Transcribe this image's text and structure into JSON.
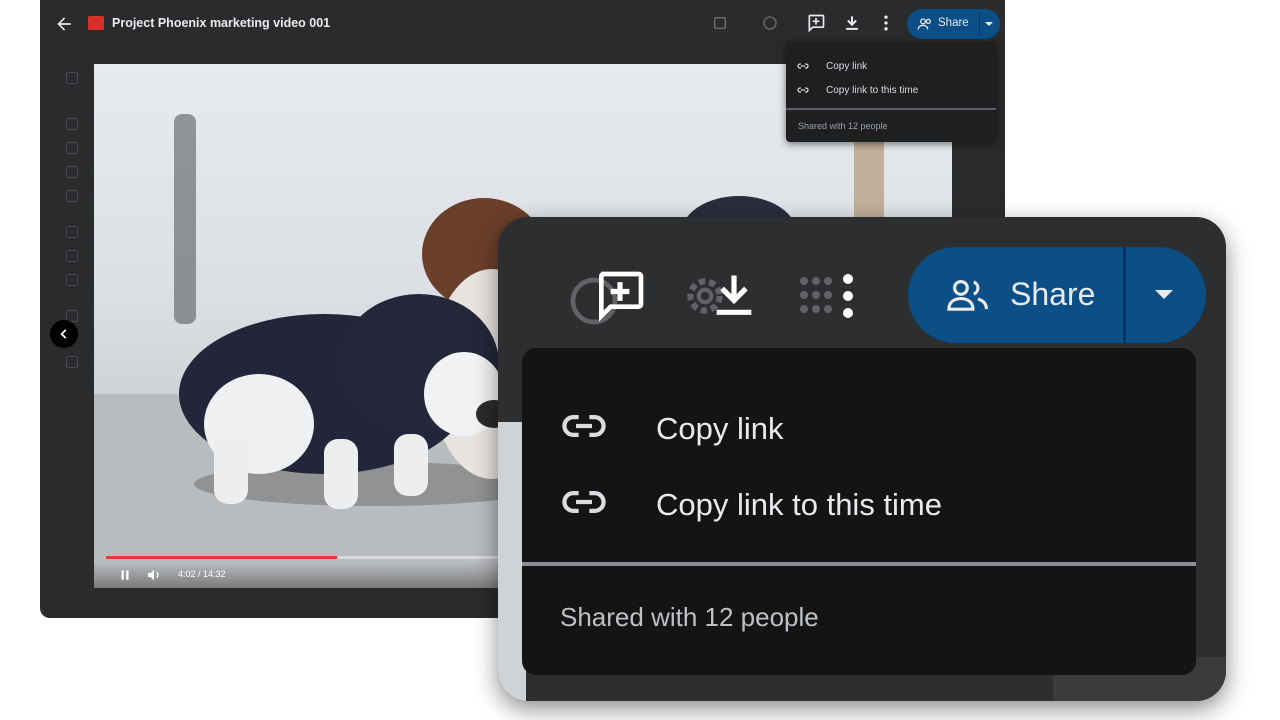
{
  "window": {
    "file_title": "Project Phoenix marketing video 001",
    "share_label": "Share"
  },
  "player": {
    "time_display": "4:02 / 14:32",
    "progress_fraction": 0.277
  },
  "share_menu": {
    "items": [
      {
        "label": "Copy link",
        "icon": "link-icon"
      },
      {
        "label": "Copy link to this time",
        "icon": "link-icon"
      }
    ],
    "footer": "Shared with 12 people"
  },
  "colors": {
    "share_button": "#0b4f86",
    "menu_background": "#141415",
    "window_background": "#2a2b2d",
    "progress": "#e53935"
  }
}
